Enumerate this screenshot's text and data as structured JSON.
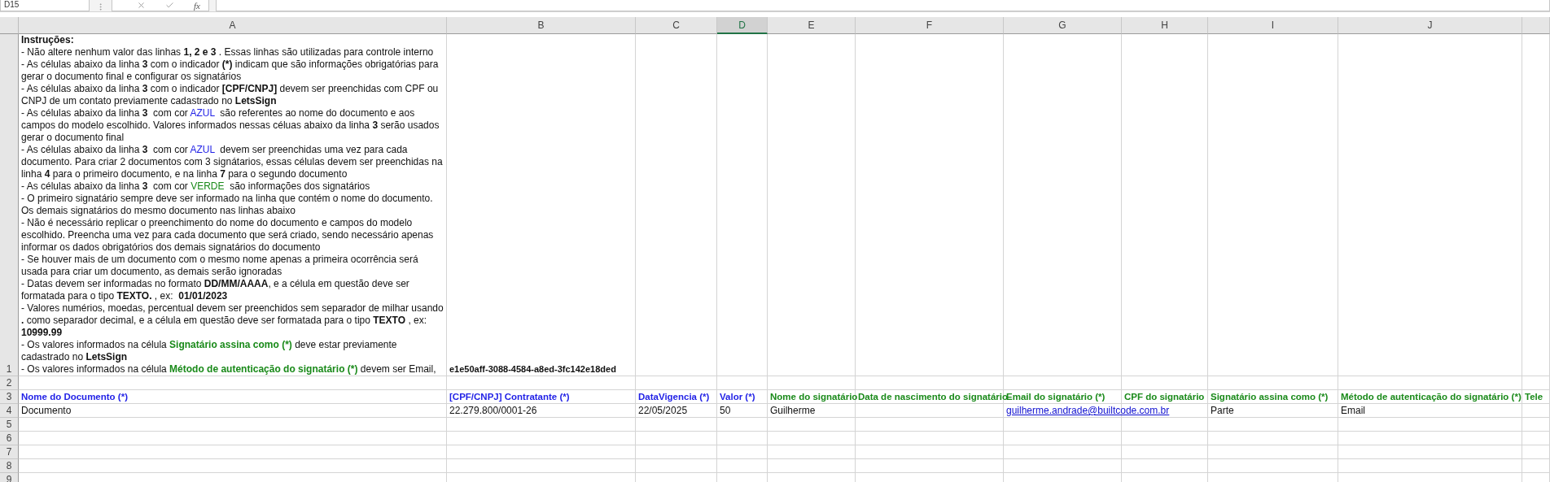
{
  "formula_bar": {
    "name_box": "D15",
    "function_label": "fx"
  },
  "columns": [
    {
      "label": "A",
      "selected": false
    },
    {
      "label": "B",
      "selected": false
    },
    {
      "label": "C",
      "selected": false
    },
    {
      "label": "D",
      "selected": true
    },
    {
      "label": "E",
      "selected": false
    },
    {
      "label": "F",
      "selected": false
    },
    {
      "label": "G",
      "selected": false
    },
    {
      "label": "H",
      "selected": false
    },
    {
      "label": "I",
      "selected": false
    },
    {
      "label": "J",
      "selected": false
    }
  ],
  "rows": [
    {
      "number": "1",
      "kind": "instructions",
      "title": "Instruções:",
      "document_id": "e1e50aff-3088-4584-a8ed-3fc142e18ded",
      "lines": [
        [
          {
            "text": "- Não altere nenhum valor das linhas ",
            "kind": "plain"
          },
          {
            "text": "1, 2 e 3",
            "kind": "bold"
          },
          {
            "text": " . Essas linhas são utilizadas para controle interno",
            "kind": "plain"
          }
        ],
        [
          {
            "text": "- As células abaixo da linha ",
            "kind": "plain"
          },
          {
            "text": "3",
            "kind": "bold"
          },
          {
            "text": " com o indicador ",
            "kind": "plain"
          },
          {
            "text": "(*)",
            "kind": "bold"
          },
          {
            "text": " indicam que são informações obrigatórias para gerar o documento final e configurar os signatários",
            "kind": "plain"
          }
        ],
        [
          {
            "text": "- As células abaixo da linha ",
            "kind": "plain"
          },
          {
            "text": "3",
            "kind": "bold"
          },
          {
            "text": " com o indicador ",
            "kind": "plain"
          },
          {
            "text": "[CPF/CNPJ]",
            "kind": "bold"
          },
          {
            "text": " devem ser preenchidas com CPF ou CNPJ de um contato previamente cadastrado no ",
            "kind": "plain"
          },
          {
            "text": "LetsSign",
            "kind": "bold"
          }
        ],
        [
          {
            "text": "- As células abaixo da linha ",
            "kind": "plain"
          },
          {
            "text": "3",
            "kind": "bold"
          },
          {
            "text": "  com cor ",
            "kind": "plain"
          },
          {
            "text": "AZUL",
            "kind": "blue"
          },
          {
            "text": "  são referentes ao nome do documento e aos campos do modelo escolhido. Valores informados nessas céluas abaixo da linha ",
            "kind": "plain"
          },
          {
            "text": "3",
            "kind": "bold"
          },
          {
            "text": " serão usados gerar o documento final",
            "kind": "plain"
          }
        ],
        [
          {
            "text": "- As células abaixo da linha ",
            "kind": "plain"
          },
          {
            "text": "3",
            "kind": "bold"
          },
          {
            "text": "  com cor ",
            "kind": "plain"
          },
          {
            "text": "AZUL",
            "kind": "blue"
          },
          {
            "text": "  devem ser preenchidas uma vez para cada documento. Para criar 2 documentos com 3 signátarios, essas células devem ser preenchidas na linha ",
            "kind": "plain"
          },
          {
            "text": "4",
            "kind": "bold"
          },
          {
            "text": " para o primeiro documento, e na linha ",
            "kind": "plain"
          },
          {
            "text": "7",
            "kind": "bold"
          },
          {
            "text": " para o segundo documento",
            "kind": "plain"
          }
        ],
        [
          {
            "text": "- As células abaixo da linha ",
            "kind": "plain"
          },
          {
            "text": "3",
            "kind": "bold"
          },
          {
            "text": "  com cor ",
            "kind": "plain"
          },
          {
            "text": "VERDE",
            "kind": "green"
          },
          {
            "text": "  são informações dos signatários",
            "kind": "plain"
          }
        ],
        [
          {
            "text": "- O primeiro signatário sempre deve ser informado na linha que contém o nome do documento. Os demais signatários do mesmo documento nas linhas abaixo",
            "kind": "plain"
          }
        ],
        [
          {
            "text": "- Não é necessário replicar o preenchimento do nome do documento e campos do modelo escolhido. Preencha uma vez para cada documento que será criado, sendo necessário apenas informar os dados obrigatórios dos demais signatários do documento",
            "kind": "plain"
          }
        ],
        [
          {
            "text": "- Se houver mais de um documento com o mesmo nome apenas a primeira ocorrência será usada para criar um documento, as demais serão ignoradas",
            "kind": "plain"
          }
        ],
        [
          {
            "text": "- Datas devem ser informadas no formato ",
            "kind": "plain"
          },
          {
            "text": "DD/MM/AAAA",
            "kind": "bold"
          },
          {
            "text": ", e a célula em questão deve ser formatada para o tipo ",
            "kind": "plain"
          },
          {
            "text": "TEXTO.",
            "kind": "bold"
          },
          {
            "text": " , ex:  ",
            "kind": "plain"
          },
          {
            "text": "01/01/2023",
            "kind": "bold"
          }
        ],
        [
          {
            "text": "- Valores numérios, moedas, percentual devem ser preenchidos sem separador de milhar usando ",
            "kind": "plain"
          },
          {
            "text": ".",
            "kind": "bold"
          },
          {
            "text": " como separador decimal, e a célula em questão deve ser formatada para o tipo ",
            "kind": "plain"
          },
          {
            "text": "TEXTO",
            "kind": "bold"
          },
          {
            "text": " , ex:  ",
            "kind": "plain"
          },
          {
            "text": "10999.99",
            "kind": "bold"
          }
        ],
        [
          {
            "text": "- Os valores informados na célula ",
            "kind": "plain"
          },
          {
            "text": "Signatário assina como (*)",
            "kind": "green_bold"
          },
          {
            "text": " deve estar previamente cadastrado no ",
            "kind": "plain"
          },
          {
            "text": "LetsSign",
            "kind": "bold"
          }
        ],
        [
          {
            "text": "- Os valores informados na célula ",
            "kind": "plain"
          },
          {
            "text": "Método de autenticação do signatário (*)",
            "kind": "green_bold"
          },
          {
            "text": " devem ser Email,",
            "kind": "plain"
          }
        ]
      ]
    },
    {
      "number": "2",
      "kind": "empty"
    },
    {
      "number": "3",
      "kind": "cells",
      "cells": [
        {
          "text": "Nome do Documento (*)",
          "kind": "blue"
        },
        {
          "text": "[CPF/CNPJ] Contratante (*)",
          "kind": "blue"
        },
        {
          "text": "DataVigencia (*)",
          "kind": "blue"
        },
        {
          "text": "Valor (*)",
          "kind": "blue"
        },
        {
          "text": "Nome do signatário",
          "kind": "green"
        },
        {
          "text": "Data de nascimento do signatário",
          "kind": "green"
        },
        {
          "text": "Email do signatário (*)",
          "kind": "green"
        },
        {
          "text": "CPF do signatário",
          "kind": "green"
        },
        {
          "text": "Signatário assina como (*)",
          "kind": "green"
        },
        {
          "text": "Método de autenticação do signatário (*)",
          "kind": "green"
        },
        {
          "text": "Tele",
          "kind": "green"
        }
      ]
    },
    {
      "number": "4",
      "kind": "cells",
      "cells": [
        {
          "text": "Documento",
          "kind": "text"
        },
        {
          "text": "22.279.800/0001-26",
          "kind": "text"
        },
        {
          "text": "22/05/2025",
          "kind": "text"
        },
        {
          "text": "50",
          "kind": "text"
        },
        {
          "text": "Guilherme",
          "kind": "text"
        },
        {
          "kind": "empty"
        },
        {
          "text": "guilherme.andrade@builtcode.com.br",
          "kind": "link"
        },
        {
          "kind": "empty"
        },
        {
          "text": "Parte",
          "kind": "text"
        },
        {
          "text": "Email",
          "kind": "text"
        },
        {
          "kind": "empty"
        }
      ]
    },
    {
      "number": "5",
      "kind": "empty"
    },
    {
      "number": "6",
      "kind": "empty"
    },
    {
      "number": "7",
      "kind": "empty"
    },
    {
      "number": "8",
      "kind": "empty"
    },
    {
      "number": "9",
      "kind": "empty"
    }
  ]
}
